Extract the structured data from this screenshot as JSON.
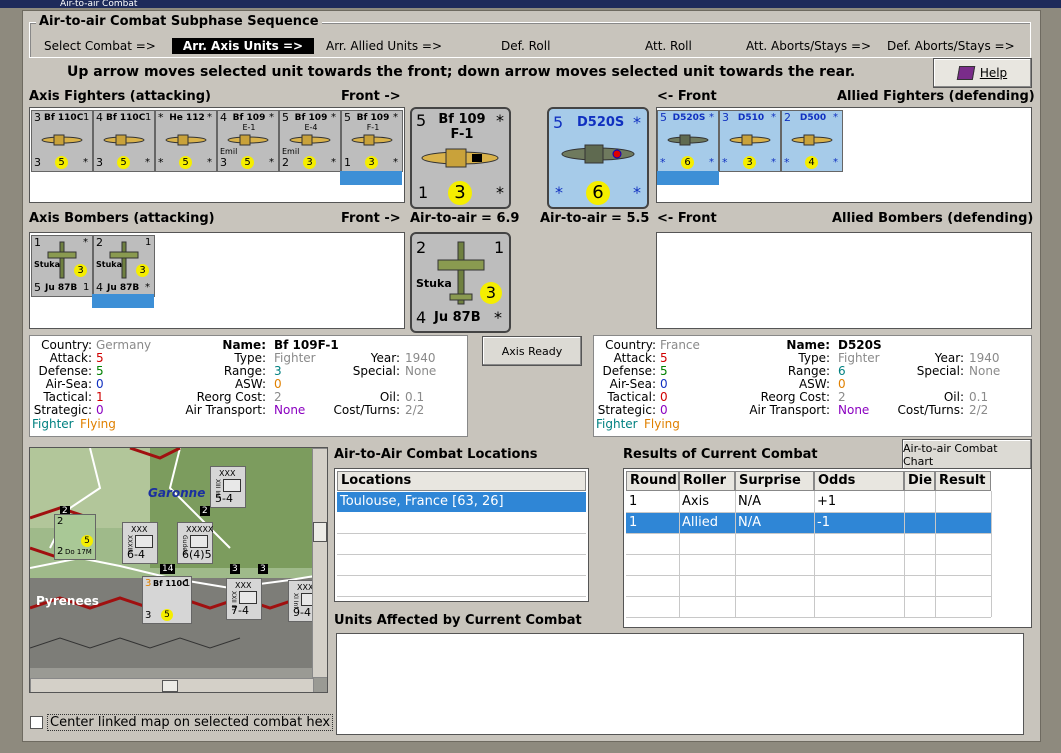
{
  "window": {
    "title": "Air-to-air Combat"
  },
  "sequence": {
    "title": "Air-to-air Combat Subphase Sequence",
    "steps": [
      "Select Combat =>",
      "Arr. Axis Units =>",
      "Arr. Allied Units =>",
      "Def. Roll",
      "Att. Roll",
      "Att. Aborts/Stays =>",
      "Def. Aborts/Stays =>"
    ],
    "active_index": 1
  },
  "instruction": "Up arrow moves selected unit towards the front; down arrow moves selected unit towards the rear.",
  "help_label": "Help",
  "labels": {
    "axis_fighters": "Axis Fighters (attacking)",
    "front_right": "Front ->",
    "front_left": "<- Front",
    "allied_fighters": "Allied Fighters (defending)",
    "axis_bombers": "Axis Bombers (attacking)",
    "allied_bombers": "Allied Bombers (defending)",
    "axis_a2a": "Air-to-air = 6.9",
    "allied_a2a": "Air-to-air = 5.5"
  },
  "axis_fighters": [
    {
      "top_left": "3",
      "name": "Bf 110C",
      "sub": "",
      "top_right": "1",
      "bottom_left": "3",
      "dot": "5",
      "bottom_right": "*"
    },
    {
      "top_left": "4",
      "name": "Bf 110C",
      "sub": "",
      "top_right": "1",
      "bottom_left": "3",
      "dot": "5",
      "bottom_right": "*"
    },
    {
      "top_left": "*",
      "name": "He 112",
      "sub": "",
      "top_right": "*",
      "bottom_left": "*",
      "dot": "5",
      "bottom_right": "*"
    },
    {
      "top_left": "4",
      "name": "Bf 109",
      "sub": "E-1",
      "top_right": "*",
      "bottom_left": "3",
      "dot": "5",
      "bottom_right": "*",
      "extra": "Emil"
    },
    {
      "top_left": "5",
      "name": "Bf 109",
      "sub": "E-4",
      "top_right": "*",
      "bottom_left": "2",
      "dot": "3",
      "bottom_right": "*",
      "extra": "Emil"
    },
    {
      "top_left": "5",
      "name": "Bf 109",
      "sub": "F-1",
      "top_right": "*",
      "bottom_left": "1",
      "dot": "3",
      "bottom_right": "*"
    }
  ],
  "allied_fighters": [
    {
      "top_left": "5",
      "name": "D520S",
      "top_right": "*",
      "bottom_left": "*",
      "dot": "6",
      "bottom_right": "*"
    },
    {
      "top_left": "3",
      "name": "D510",
      "top_right": "*",
      "bottom_left": "*",
      "dot": "3",
      "bottom_right": "*"
    },
    {
      "top_left": "2",
      "name": "D500",
      "top_right": "*",
      "bottom_left": "*",
      "dot": "4",
      "bottom_right": "*"
    }
  ],
  "axis_bombers": [
    {
      "top_left": "1",
      "top_right": "*",
      "mid": "Stuka",
      "dot": "3",
      "bottom_left": "5",
      "name": "Ju 87B",
      "bottom_right": "1"
    },
    {
      "top_left": "2",
      "top_right": "1",
      "mid": "Stuka",
      "dot": "3",
      "bottom_left": "4",
      "name": "Ju 87B",
      "bottom_right": "*"
    }
  ],
  "axis_front_fighter": {
    "top_left": "5",
    "name": "Bf 109",
    "sub": "F-1",
    "top_right": "*",
    "bottom_left": "1",
    "dot": "3",
    "bottom_right": "*"
  },
  "allied_front_fighter": {
    "top_left": "5",
    "name": "D520S",
    "top_right": "*",
    "bottom_left": "*",
    "dot": "6",
    "bottom_right": "*"
  },
  "axis_front_bomber": {
    "top_left": "2",
    "top_right": "1",
    "mid": "Stuka",
    "dot": "3",
    "bottom_left": "4",
    "name": "Ju 87B",
    "bottom_right": "*"
  },
  "axis_info": {
    "country_label": "Country:",
    "country": "Germany",
    "attack_label": "Attack:",
    "attack": "5",
    "defense_label": "Defense:",
    "defense": "5",
    "airsea_label": "Air-Sea:",
    "airsea": "0",
    "tactical_label": "Tactical:",
    "tactical": "1",
    "strategic_label": "Strategic:",
    "strategic": "0",
    "class": "Fighter",
    "status": "Flying",
    "name_label": "Name:",
    "name": "Bf 109F-1",
    "type_label": "Type:",
    "type": "Fighter",
    "range_label": "Range:",
    "range": "3",
    "asw_label": "ASW:",
    "asw": "0",
    "reorg_label": "Reorg Cost:",
    "reorg": "2",
    "transport_label": "Air Transport:",
    "transport": "None",
    "year_label": "Year:",
    "year": "1940",
    "special_label": "Special:",
    "special": "None",
    "oil_label": "Oil:",
    "oil": "0.1",
    "cost_label": "Cost/Turns:",
    "cost": "2/2"
  },
  "allied_info": {
    "country_label": "Country:",
    "country": "France",
    "attack_label": "Attack:",
    "attack": "5",
    "defense_label": "Defense:",
    "defense": "5",
    "airsea_label": "Air-Sea:",
    "airsea": "0",
    "tactical_label": "Tactical:",
    "tactical": "0",
    "strategic_label": "Strategic:",
    "strategic": "0",
    "class": "Fighter",
    "status": "Flying",
    "name_label": "Name:",
    "name": "D520S",
    "type_label": "Type:",
    "type": "Fighter",
    "range_label": "Range:",
    "range": "6",
    "asw_label": "ASW:",
    "asw": "0",
    "reorg_label": "Reorg Cost:",
    "reorg": "2",
    "transport_label": "Air Transport:",
    "transport": "None",
    "year_label": "Year:",
    "year": "1940",
    "special_label": "Special:",
    "special": "None",
    "oil_label": "Oil:",
    "oil": "0.1",
    "cost_label": "Cost/Turns:",
    "cost": "2/2"
  },
  "axis_ready_label": "Axis Ready",
  "map": {
    "labels": {
      "garonne": "Garonne",
      "pyrenees": "Pyrenees"
    },
    "units": [
      {
        "top": "XXX",
        "side": "XIII Inf",
        "value": "5-4"
      },
      {
        "top": "XXX",
        "side": "XXXIII Inf",
        "value": "6-4"
      },
      {
        "top": "XXXXX",
        "side": "Guderian",
        "value": "6(4)5"
      },
      {
        "top": "XXX",
        "side": "XXII Inf",
        "value": "7-4"
      },
      {
        "top": "XXX",
        "side": "XI Inf",
        "value": "9-4"
      }
    ],
    "stack_numbers": [
      "2",
      "2",
      "3",
      "14",
      "3"
    ],
    "air_unit": {
      "top_left": "3",
      "name": "Bf 110C",
      "top_right": "1",
      "bottom_left": "3",
      "dot": "5"
    },
    "bomber_unit": {
      "top_left": "2",
      "name": "Do 17M",
      "bottom_left": "2",
      "dot": "5"
    }
  },
  "locations": {
    "title": "Air-to-Air Combat Locations",
    "header": "Locations",
    "rows": [
      "Toulouse, France [63, 26]"
    ]
  },
  "results": {
    "title": "Results of Current Combat",
    "chart_button": "Air-to-air Combat Chart",
    "columns": [
      "Round",
      "Roller",
      "Surprise",
      "Odds",
      "Die",
      "Result"
    ],
    "rows": [
      [
        "1",
        "Axis",
        "N/A",
        "+1",
        "",
        ""
      ],
      [
        "1",
        "Allied",
        "N/A",
        "-1",
        "",
        ""
      ]
    ]
  },
  "affected": {
    "title": "Units Affected by Current Combat"
  },
  "center_map": {
    "label": "Center linked map on selected combat hex"
  }
}
